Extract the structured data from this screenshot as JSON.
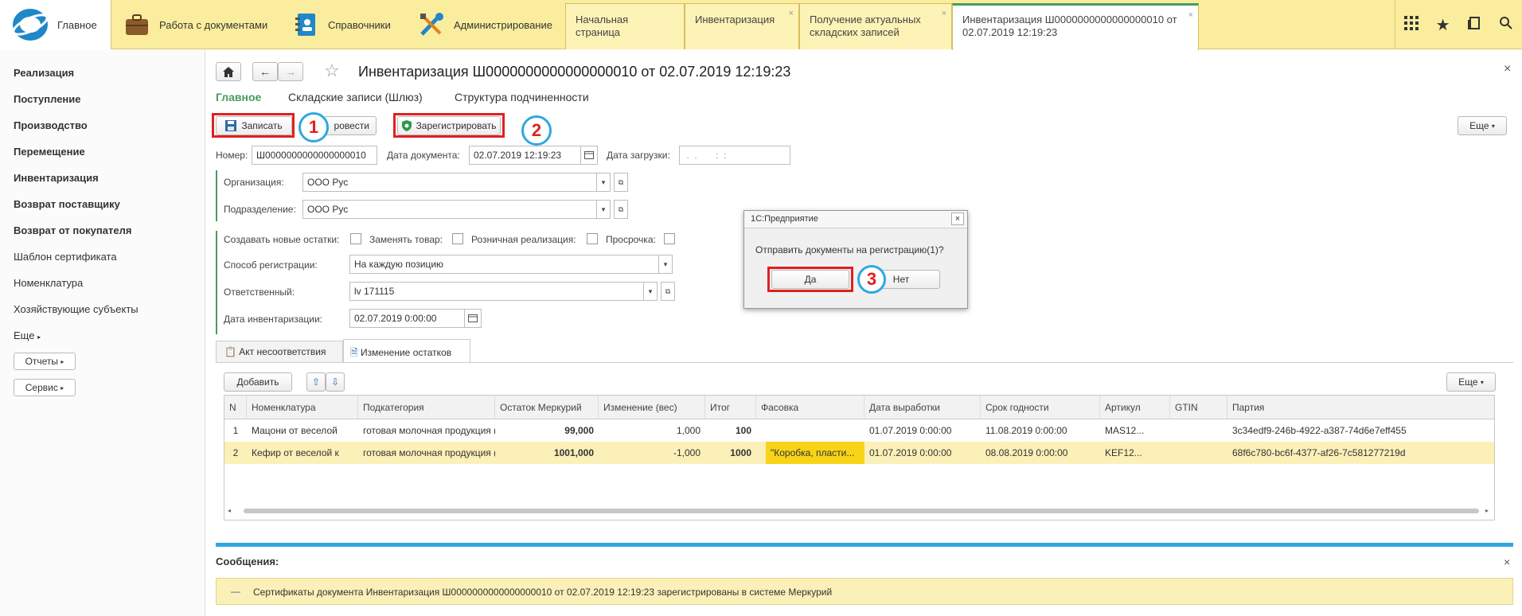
{
  "topbar": {
    "sections": {
      "home": "Главное",
      "docs": "Работа с документами",
      "refs": "Справочники",
      "admin": "Администрирование"
    },
    "tabs": [
      {
        "label": "Начальная страница"
      },
      {
        "label": "Инвентаризация"
      },
      {
        "label": "Получение актуальных складских записей"
      },
      {
        "label": "Инвентаризация Ш0000000000000000010 от 02.07.2019 12:19:23"
      }
    ],
    "close_glyph": "×"
  },
  "sidebar": {
    "items": [
      "Реализация",
      "Поступление",
      "Производство",
      "Перемещение",
      "Инвентаризация",
      "Возврат поставщику",
      "Возврат от покупателя",
      "Шаблон сертификата",
      "Номенклатура",
      "Хозяйствующие субъекты"
    ],
    "more": "Еще",
    "reports": "Отчеты",
    "service": "Сервис"
  },
  "doc": {
    "title": "Инвентаризация Ш0000000000000000010 от 02.07.2019 12:19:23",
    "nav_tabs": [
      "Главное",
      "Складские записи (Шлюз)",
      "Структура подчиненности"
    ],
    "save_label": "Записать",
    "post_label": "Провести",
    "post_label_visible": "ровести",
    "register_label": "Зарегистрировать",
    "more_label": "Еще",
    "markers": [
      "1",
      "2",
      "3"
    ],
    "fields": {
      "number_label": "Номер:",
      "number_value": "Ш0000000000000000010",
      "date_label": "Дата документа:",
      "date_value": "02.07.2019 12:19:23",
      "load_label": "Дата загрузки:",
      "load_value": " .  .       :  :",
      "org_label": "Организация:",
      "org_value": "ООО Рус",
      "dept_label": "Подразделение:",
      "dept_value": "ООО Рус",
      "chk_new": "Создавать новые остатки:",
      "chk_replace": "Заменять товар:",
      "chk_retail": "Розничная реализация:",
      "chk_overdue": "Просрочка:",
      "regmode_label": "Способ регистрации:",
      "regmode_value": "На каждую позицию",
      "resp_label": "Ответственный:",
      "resp_value": "lv  171115",
      "invdate_label": "Дата инвентаризации:",
      "invdate_value": "02.07.2019  0:00:00"
    },
    "subtabs": [
      "Акт несоответствия",
      "Изменение остатков"
    ],
    "add_label": "Добавить",
    "grid_more": "Еще",
    "columns": [
      "N",
      "Номенклатура",
      "Подкатегория",
      "Остаток Меркурий",
      "Изменение (вес)",
      "Итог",
      "Фасовка",
      "Дата выработки",
      "Срок годности",
      "Артикул",
      "GTIN",
      "Партия"
    ],
    "rows": [
      {
        "n": "1",
        "name": "Мацони от веселой",
        "sub": "готовая молочная продукция ()",
        "rest": "99,000",
        "change": "1,000",
        "total": "100",
        "pack": "",
        "made": "01.07.2019 0:00:00",
        "exp": "11.08.2019 0:00:00",
        "art": "MAS12...",
        "gtin": "",
        "batch": "3c34edf9-246b-4922-a387-74d6e7eff455"
      },
      {
        "n": "2",
        "name": "Кефир от веселой к",
        "sub": "готовая молочная продукция ()",
        "rest": "1001,000",
        "change": "-1,000",
        "total": "1000",
        "pack": "\"Коробка, пласти...",
        "made": "01.07.2019 0:00:00",
        "exp": "08.08.2019 0:00:00",
        "art": "KEF12...",
        "gtin": "",
        "batch": "68f6c780-bc6f-4377-af26-7c581277219d"
      }
    ]
  },
  "dialog": {
    "title": "1С:Предприятие",
    "text": "Отправить документы на регистрацию(1)?",
    "yes": "Да",
    "no": "Нет"
  },
  "messages": {
    "title": "Сообщения:",
    "dash": "—",
    "text": "Сертификаты документа Инвентаризация Ш0000000000000000010 от 02.07.2019 12:19:23 зарегистрированы в системе Меркурий"
  },
  "colors": {
    "accent_green": "#4a9a5c",
    "marker_red": "#e02020",
    "marker_blue": "#2ea8e0",
    "topbar": "#fbed9e",
    "highlight_row": "#fbf0b8",
    "pack_cell": "#f7d417"
  }
}
